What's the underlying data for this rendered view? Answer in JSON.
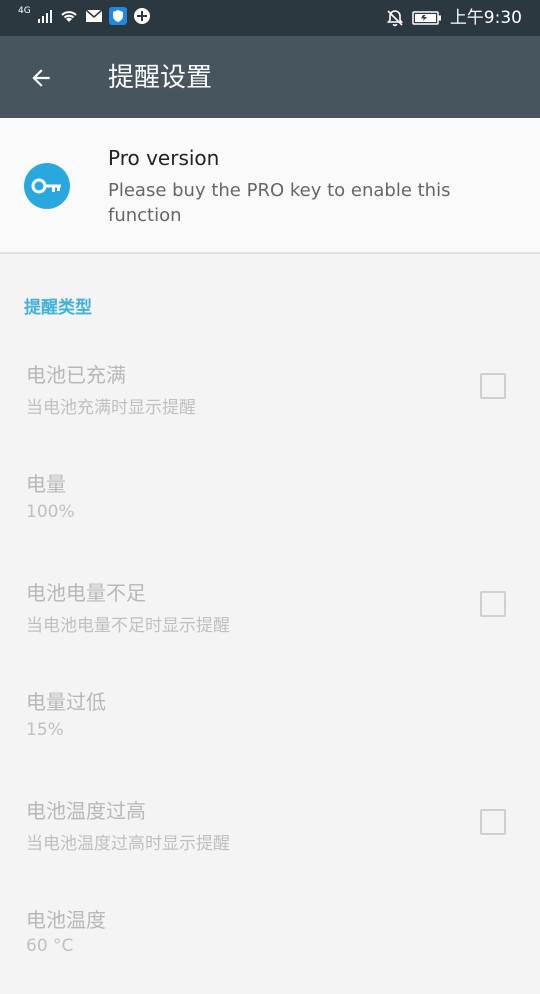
{
  "status_bar": {
    "network": "4G",
    "time": "上午9:30"
  },
  "app_bar": {
    "title": "提醒设置"
  },
  "pro_card": {
    "title": "Pro version",
    "description": "Please buy the PRO key to enable this function",
    "icon": "key-icon",
    "accent_color": "#29a8e0"
  },
  "section": {
    "header": "提醒类型",
    "header_color": "#3fb2dc"
  },
  "preferences": [
    {
      "title": "电池已充满",
      "summary": "当电池充满时显示提醒",
      "has_checkbox": true,
      "checked": false
    },
    {
      "title": "电量",
      "summary": "100%",
      "has_checkbox": false
    },
    {
      "title": "电池电量不足",
      "summary": "当电池电量不足时显示提醒",
      "has_checkbox": true,
      "checked": false
    },
    {
      "title": "电量过低",
      "summary": "15%",
      "has_checkbox": false
    },
    {
      "title": "电池温度过高",
      "summary": "当电池温度过高时显示提醒",
      "has_checkbox": true,
      "checked": false
    },
    {
      "title": "电池温度",
      "summary": "60 °C",
      "has_checkbox": false
    }
  ]
}
